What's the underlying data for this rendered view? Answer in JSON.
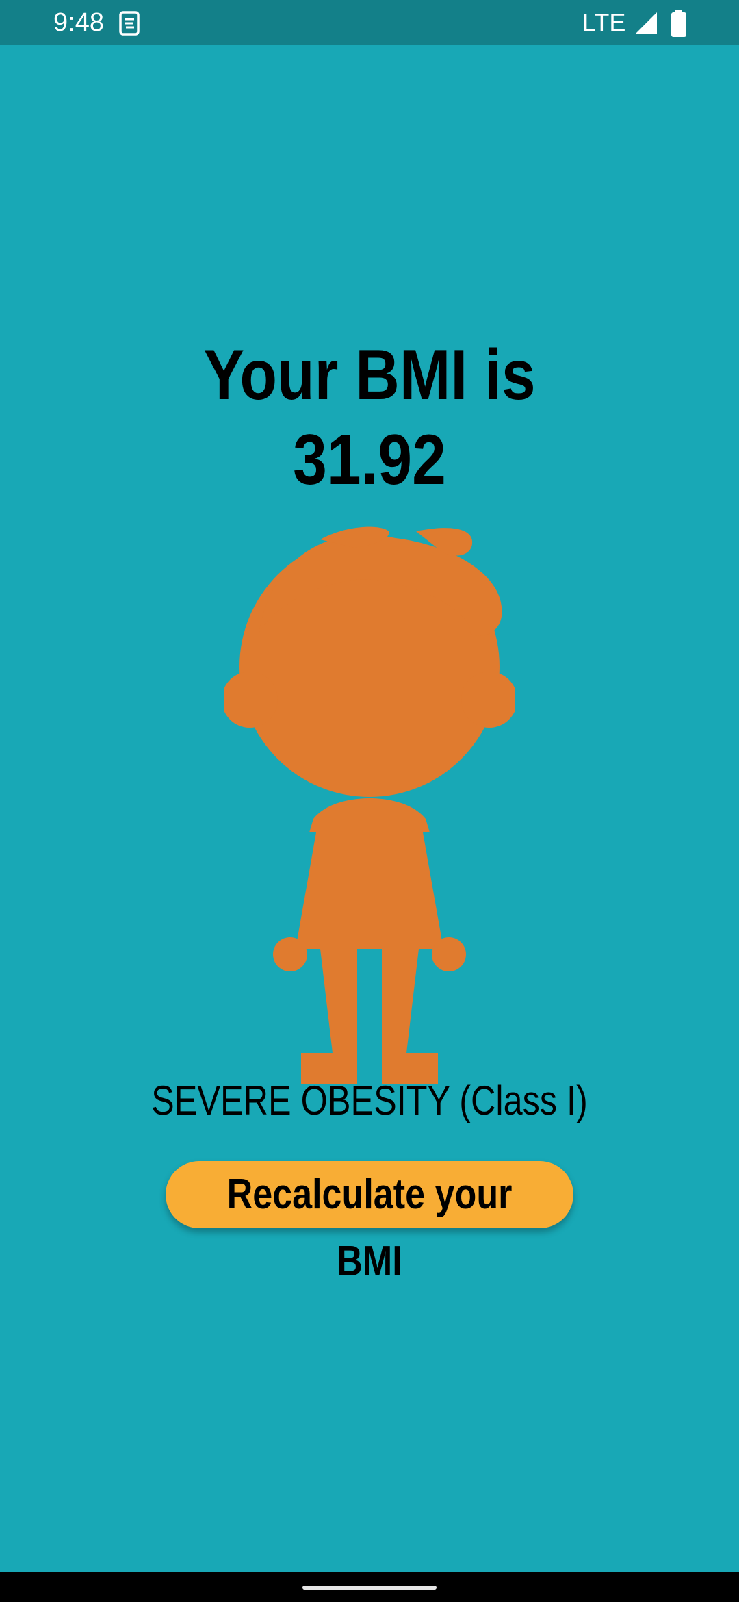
{
  "status_bar": {
    "time": "9:48",
    "network": "LTE",
    "icons": [
      "sim-card-icon",
      "cell-signal-icon",
      "battery-icon"
    ]
  },
  "result": {
    "title": "Your BMI is",
    "value": "31.92",
    "category": "SEVERE OBESITY (Class I)",
    "figure_icon": "person-silhouette-icon"
  },
  "actions": {
    "recalculate_label": "Recalculate your BMI"
  },
  "colors": {
    "background": "#18a8b6",
    "status_bar": "#138089",
    "figure": "#e07b2f",
    "button": "#f8ad35",
    "text": "#000000"
  }
}
